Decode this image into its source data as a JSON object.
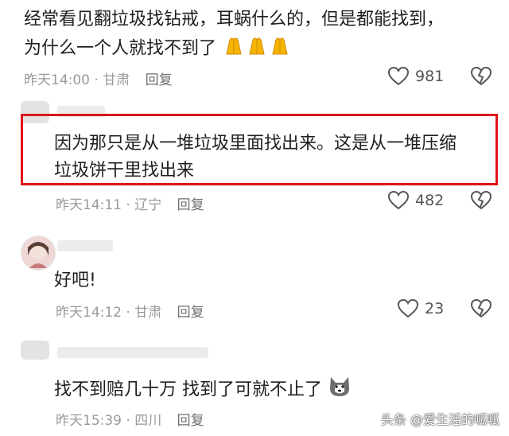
{
  "comments": [
    {
      "text_line1": "经常看见翻垃圾找钻戒，耳蜗什么的，但是都能找到，",
      "text_line2": "为什么一个人就找不到了",
      "time": "昨天14:00",
      "location": "甘肃",
      "reply": "回复",
      "likes": "981"
    },
    {
      "text_line1": "因为那只是从一堆垃圾里面找出来。这是从一堆压缩",
      "text_line2": "垃圾饼干里找出来",
      "time": "昨天14:11",
      "location": "辽宁",
      "reply": "回复",
      "likes": "482"
    },
    {
      "text_line1": "好吧!",
      "time": "昨天14:12",
      "location": "甘肃",
      "reply": "回复",
      "likes": "23"
    },
    {
      "text_line1": "找不到赔几十万 找到了可就不止了",
      "time": "昨天15:39",
      "location": "四川",
      "reply": "回复",
      "likes": ""
    }
  ],
  "watermark": "头条 @爱生活的呱呱",
  "colors": {
    "highlight": "#e0131a",
    "meta": "#9a9a9a"
  }
}
